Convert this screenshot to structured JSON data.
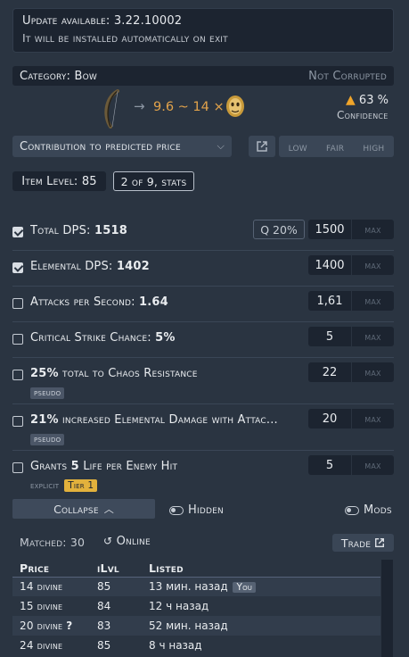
{
  "update": {
    "title": "Update available: 3.22.10002",
    "subtitle": "It will be installed automatically on exit"
  },
  "category": {
    "label": "Category: Bow",
    "corruption": "Not Corrupted"
  },
  "prediction": {
    "arrow": "→",
    "range": "9.6 ~ 14 ×",
    "currency_icon": "divine-orb-icon",
    "warning_icon": "warning-icon",
    "confidence_value": "63 %",
    "confidence_label": "Confidence"
  },
  "toolbar": {
    "contribution_label": "Contribution to predicted price",
    "filters": [
      "low",
      "fair",
      "high"
    ]
  },
  "item": {
    "level_label": "Item Level: 85",
    "stats_label": "2 of 9, stats"
  },
  "stats": [
    {
      "name_pre": "Total DPS: ",
      "name_val": "1518",
      "checked": true,
      "value": "1500",
      "max": "max",
      "quality": "Q 20%"
    },
    {
      "name_pre": "Elemental DPS: ",
      "name_val": "1402",
      "checked": true,
      "value": "1400",
      "max": "max"
    },
    {
      "name_pre": "Attacks per Second: ",
      "name_val": "1.64",
      "checked": false,
      "value": "1,61",
      "max": "max"
    },
    {
      "name_pre": "Critical Strike Chance: ",
      "name_val": "5%",
      "checked": false,
      "value": "5",
      "max": "max"
    },
    {
      "name_pre": "25%",
      "name_val": " total to Chaos Resistance",
      "checked": false,
      "value": "22",
      "max": "max",
      "tag": "pseudo"
    },
    {
      "name_pre": "21%",
      "name_val": " increased Elemental Damage with Attac...",
      "checked": false,
      "value": "20",
      "max": "max",
      "tag": "pseudo"
    },
    {
      "name_pre": "Grants ",
      "name_bold": "5",
      "name_post": " Life per Enemy Hit",
      "checked": false,
      "value": "5",
      "max": "max",
      "source": "explicit",
      "tier": "Tier 1"
    }
  ],
  "controls": {
    "collapse_label": "Collapse",
    "hidden_label": "Hidden",
    "mods_label": "Mods"
  },
  "results": {
    "matched": "Matched: 30",
    "online": "Online",
    "trade": "Trade",
    "columns": [
      "Price",
      "iLvl",
      "Listed"
    ],
    "rows": [
      {
        "price": "14 divine",
        "ilvl": "85",
        "listed": "13 мин. назад",
        "badge": "You"
      },
      {
        "price": "15 divine",
        "ilvl": "84",
        "listed": "12 ч назад"
      },
      {
        "price": "20 divine",
        "ilvl": "83",
        "listed": "52 мин. назад",
        "unsure": "?"
      },
      {
        "price": "24 divine",
        "ilvl": "85",
        "listed": "8 ч назад"
      }
    ]
  },
  "colors": {
    "background": "#2a3441",
    "panel": "#1c2430",
    "accent_gold": "#e2a34b",
    "warning": "#f0a52a"
  }
}
